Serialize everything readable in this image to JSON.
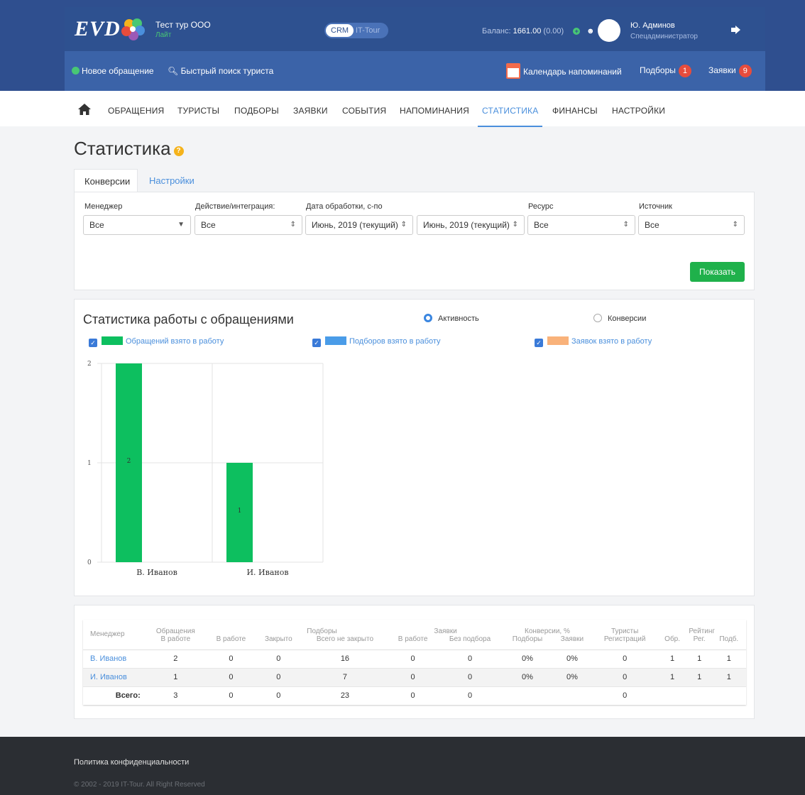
{
  "header": {
    "logo": "EVD",
    "company": "Тест тур ООО",
    "plan": "Лайт",
    "switch_on": "CRM",
    "switch_off": "IT-Tour",
    "balance_label": "Баланс:",
    "balance_value": "1661.00",
    "balance_extra": "(0.00)",
    "user_name": "Ю. Админов",
    "user_role": "Спецадминистратор",
    "colors": {
      "primary": "#2e5190",
      "accent": "#48c774",
      "badge": "#e74c3c"
    }
  },
  "actions": {
    "new_request": "Новое обращение",
    "quick_search": "Быстрый поиск туриста",
    "calendar": "Календарь напоминаний",
    "selections": "Подборы",
    "selections_count": "1",
    "orders": "Заявки",
    "orders_count": "9"
  },
  "nav": {
    "items": [
      "Обращения",
      "Туристы",
      "Подборы",
      "Заявки",
      "События",
      "Напоминания",
      "Статистика",
      "Финансы",
      "Настройки"
    ],
    "active": "Статистика"
  },
  "page": {
    "title": "Статистика"
  },
  "tabs": [
    "Конверсии",
    "Настройки"
  ],
  "filters": {
    "manager_label": "Менеджер",
    "manager_value": "Все",
    "action_label": "Действие/интеграция:",
    "action_value": "Все",
    "date_label": "Дата обработки, с-по",
    "date_from": "Июнь, 2019 (текущий)",
    "date_to": "Июнь, 2019 (текущий)",
    "resource_label": "Ресурс",
    "resource_value": "Все",
    "source_label": "Источник",
    "source_value": "Все",
    "show_button": "Показать"
  },
  "chart_section": {
    "title": "Статистика работы с обращениями",
    "radio_activity": "Активность",
    "radio_conversion": "Конверсии"
  },
  "chart_data": {
    "type": "bar",
    "categories": [
      "В. Иванов",
      "И. Иванов"
    ],
    "series": [
      {
        "name": "Обращений взято в работу",
        "color": "#0dbf5f",
        "values": [
          2,
          1
        ]
      },
      {
        "name": "Подборов взято в работу",
        "color": "#4a9ce8",
        "values": [
          0,
          0
        ]
      },
      {
        "name": "Заявок взято в работу",
        "color": "#f9b27a",
        "values": [
          0,
          0
        ]
      }
    ],
    "ylim": [
      0,
      2
    ],
    "yticks": [
      "0",
      "1",
      "2"
    ],
    "grid": true,
    "legend_position": "top"
  },
  "table": {
    "group_headers": [
      "Менеджер",
      "Обращения",
      "Подборы",
      "Заявки",
      "Конверсии, %",
      "Туристы",
      "Рейтинг"
    ],
    "sub_headers": [
      "В работе",
      "В работе",
      "Закрыто",
      "Всего не закрыто",
      "В работе",
      "Без подбора",
      "Подборы",
      "Заявки",
      "Регистраций",
      "Обр.",
      "Рег.",
      "Подб."
    ],
    "rows": [
      {
        "manager": "В. Иванов",
        "cells": [
          "2",
          "0",
          "0",
          "16",
          "0",
          "0",
          "0%",
          "0%",
          "0",
          "1",
          "1",
          "1"
        ]
      },
      {
        "manager": "И. Иванов",
        "cells": [
          "1",
          "0",
          "0",
          "7",
          "0",
          "0",
          "0%",
          "0%",
          "0",
          "1",
          "1",
          "1"
        ]
      }
    ],
    "total_label": "Всего:",
    "totals": [
      "3",
      "0",
      "0",
      "23",
      "0",
      "0",
      "",
      "",
      "0",
      "",
      "",
      ""
    ]
  },
  "footer": {
    "privacy": "Политика конфиденциальности",
    "copyright": "© 2002 - 2019 IT-Tour. All Right Reserved"
  }
}
